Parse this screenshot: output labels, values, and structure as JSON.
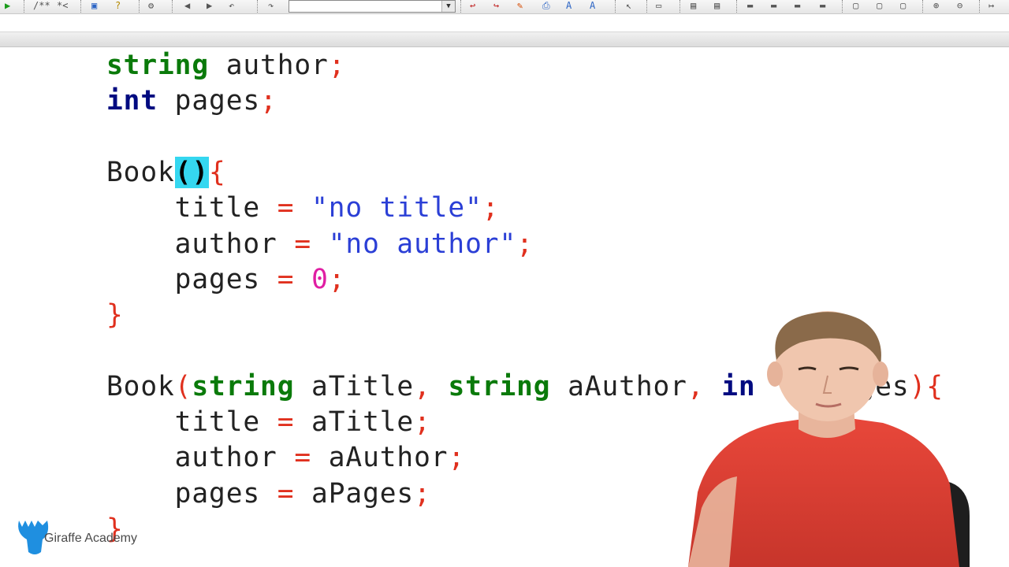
{
  "toolbar": {
    "combo_value": "",
    "icons": [
      "run-icon",
      "comment-icon",
      "save-icon",
      "help-icon",
      "undo-icon",
      "redo-icon",
      "search-icon",
      "replace-icon",
      "zoom-in-icon",
      "zoom-out-icon"
    ]
  },
  "code": {
    "lines": [
      {
        "tokens": [
          [
            "kw",
            "string"
          ],
          [
            "txt",
            " author"
          ],
          [
            "op",
            ";"
          ]
        ]
      },
      {
        "tokens": [
          [
            "kw2",
            "int"
          ],
          [
            "txt",
            " pages"
          ],
          [
            "op",
            ";"
          ]
        ]
      },
      {
        "tokens": []
      },
      {
        "tokens": [
          [
            "txt",
            "Book"
          ],
          [
            "hl",
            "()"
          ],
          [
            "op",
            "{"
          ]
        ]
      },
      {
        "tokens": [
          [
            "txt",
            "    title "
          ],
          [
            "op",
            "="
          ],
          [
            "txt",
            " "
          ],
          [
            "str",
            "\"no title\""
          ],
          [
            "op",
            ";"
          ]
        ]
      },
      {
        "tokens": [
          [
            "txt",
            "    author "
          ],
          [
            "op",
            "="
          ],
          [
            "txt",
            " "
          ],
          [
            "str",
            "\"no author\""
          ],
          [
            "op",
            ";"
          ]
        ]
      },
      {
        "tokens": [
          [
            "txt",
            "    pages "
          ],
          [
            "op",
            "="
          ],
          [
            "txt",
            " "
          ],
          [
            "num",
            "0"
          ],
          [
            "op",
            ";"
          ]
        ]
      },
      {
        "tokens": [
          [
            "op",
            "}"
          ]
        ]
      },
      {
        "tokens": []
      },
      {
        "tokens": [
          [
            "txt",
            "Book"
          ],
          [
            "op",
            "("
          ],
          [
            "kw",
            "string"
          ],
          [
            "txt",
            " aTitle"
          ],
          [
            "op",
            ","
          ],
          [
            "txt",
            " "
          ],
          [
            "kw",
            "string"
          ],
          [
            "txt",
            " aAuthor"
          ],
          [
            "op",
            ","
          ],
          [
            "txt",
            " "
          ],
          [
            "kw2",
            "in"
          ],
          [
            "txt",
            "    Pages"
          ],
          [
            "op",
            ")"
          ],
          [
            "op",
            "{"
          ]
        ]
      },
      {
        "tokens": [
          [
            "txt",
            "    title "
          ],
          [
            "op",
            "="
          ],
          [
            "txt",
            " aTitle"
          ],
          [
            "op",
            ";"
          ]
        ]
      },
      {
        "tokens": [
          [
            "txt",
            "    author "
          ],
          [
            "op",
            "="
          ],
          [
            "txt",
            " aAuthor"
          ],
          [
            "op",
            ";"
          ]
        ]
      },
      {
        "tokens": [
          [
            "txt",
            "    pages "
          ],
          [
            "op",
            "="
          ],
          [
            "txt",
            " aPages"
          ],
          [
            "op",
            ";"
          ]
        ]
      },
      {
        "tokens": [
          [
            "op",
            "}"
          ]
        ]
      }
    ]
  },
  "logo": {
    "text": "Giraffe Academy"
  },
  "colors": {
    "keyword": "#0a7a0a",
    "type_keyword": "#000a80",
    "operator": "#e0301e",
    "string": "#2b3fd6",
    "number": "#e01ea3",
    "highlight": "#35d7f0",
    "logo": "#1f8fe0"
  }
}
